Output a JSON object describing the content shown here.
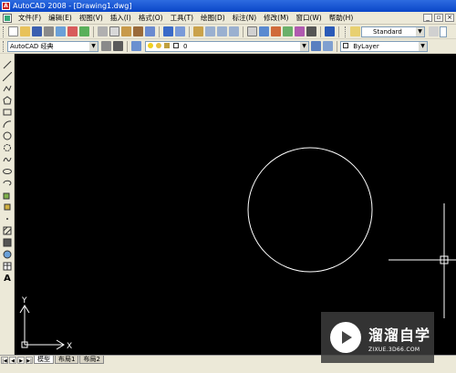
{
  "window": {
    "title": "AutoCAD 2008 - [Drawing1.dwg]"
  },
  "menu": {
    "items": [
      "文件(F)",
      "编辑(E)",
      "视图(V)",
      "插入(I)",
      "格式(O)",
      "工具(T)",
      "绘图(D)",
      "标注(N)",
      "修改(M)",
      "窗口(W)",
      "帮助(H)"
    ]
  },
  "toolbar": {
    "text_style": "Standard",
    "workspace": "AutoCAD 经典",
    "layer": "0",
    "color": "ByLayer"
  },
  "ucs": {
    "x_label": "X",
    "y_label": "Y"
  },
  "tabs": {
    "model": "模型",
    "layout1": "布局1",
    "layout2": "布局2"
  },
  "watermark": {
    "name": "溜溜自学",
    "url": "ZIXUE.3D66.COM"
  },
  "colors": {
    "canvas": "#000000",
    "geometry": "#ffffff",
    "title_bar": "#0a46c8"
  }
}
